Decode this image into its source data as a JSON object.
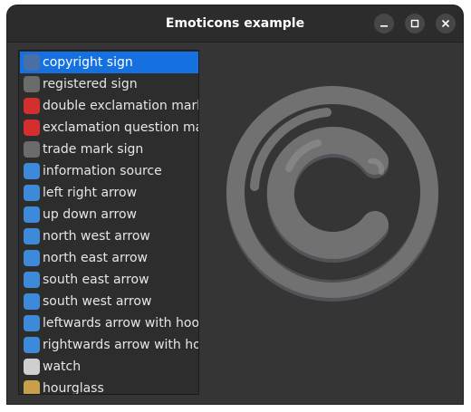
{
  "window": {
    "title": "Emoticons example"
  },
  "list": {
    "items": [
      {
        "label": "copyright sign",
        "icon": "copyright-icon",
        "color": "#4a6fa5",
        "selected": true
      },
      {
        "label": "registered sign",
        "icon": "registered-icon",
        "color": "#6b6b6b"
      },
      {
        "label": "double exclamation mark",
        "icon": "double-exclamation-icon",
        "color": "#d32f2f"
      },
      {
        "label": "exclamation question mark",
        "icon": "exclamation-question-icon",
        "color": "#d32f2f"
      },
      {
        "label": "trade mark sign",
        "icon": "trademark-icon",
        "color": "#6b6b6b"
      },
      {
        "label": "information source",
        "icon": "information-icon",
        "color": "#3f8ad8"
      },
      {
        "label": "left right arrow",
        "icon": "left-right-arrow-icon",
        "color": "#3f8ad8"
      },
      {
        "label": "up down arrow",
        "icon": "up-down-arrow-icon",
        "color": "#3f8ad8"
      },
      {
        "label": "north west arrow",
        "icon": "north-west-arrow-icon",
        "color": "#3f8ad8"
      },
      {
        "label": "north east arrow",
        "icon": "north-east-arrow-icon",
        "color": "#3f8ad8"
      },
      {
        "label": "south east arrow",
        "icon": "south-east-arrow-icon",
        "color": "#3f8ad8"
      },
      {
        "label": "south west arrow",
        "icon": "south-west-arrow-icon",
        "color": "#3f8ad8"
      },
      {
        "label": "leftwards arrow with hook",
        "icon": "leftwards-hook-arrow-icon",
        "color": "#3f8ad8"
      },
      {
        "label": "rightwards arrow with hook",
        "icon": "rightwards-hook-arrow-icon",
        "color": "#3f8ad8"
      },
      {
        "label": "watch",
        "icon": "watch-icon",
        "color": "#cfcfcf"
      },
      {
        "label": "hourglass",
        "icon": "hourglass-icon",
        "color": "#c8a04a"
      }
    ]
  },
  "preview": {
    "icon": "copyright-icon"
  }
}
